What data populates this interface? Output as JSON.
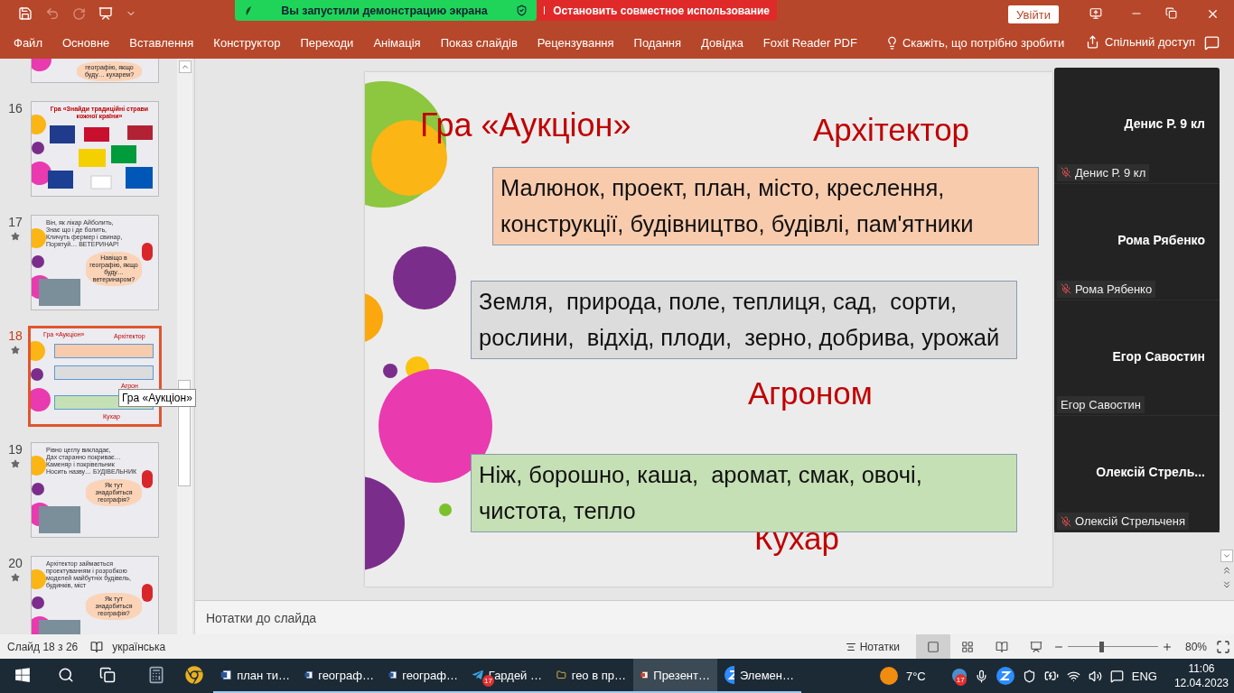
{
  "title_bar": {
    "share_banner": "Вы запустили демонстрацию экрана",
    "stop_button": "Остановить совместное использование",
    "sign_in": "Увійти"
  },
  "ribbon_tabs": [
    {
      "label": "Файл"
    },
    {
      "label": "Основне"
    },
    {
      "label": "Вставлення"
    },
    {
      "label": "Конструктор"
    },
    {
      "label": "Переходи"
    },
    {
      "label": "Анімація"
    },
    {
      "label": "Показ слайдів"
    },
    {
      "label": "Рецензування"
    },
    {
      "label": "Подання"
    },
    {
      "label": "Довідка"
    },
    {
      "label": "Foxit Reader PDF"
    }
  ],
  "tell_me": "Скажіть, що потрібно зробити",
  "share": "Спільний доступ",
  "thumbnails": [
    {
      "kind": "partial",
      "selected": false,
      "cloud": "географію, якщо буду… кухарем?"
    },
    {
      "kind": "flags",
      "number": "16",
      "selected": false,
      "lines": [
        "Гра «Знайди традиційні страви кожної країни»"
      ]
    },
    {
      "kind": "poem",
      "number": "17",
      "selected": false,
      "starred": true,
      "lines": [
        "Він, як лікар Айболить,",
        "Знає що і де болить,",
        "Кличуть фермер і свинар,",
        "Порятуй… ВЕТЕРИНАР!"
      ],
      "cloud": "Навіщо в географію, якщо буду… ветеринаром?"
    },
    {
      "kind": "mini",
      "number": "18",
      "selected": true,
      "starred": true,
      "lines": [
        "Гра «Аукціон»",
        "Архітектор",
        "Агрон",
        "Кухар"
      ]
    },
    {
      "kind": "poem",
      "number": "19",
      "selected": false,
      "starred": true,
      "lines": [
        "Рівно цеглу викладає,",
        "Дах старанно покриває…",
        "Каменяр і покрівельник",
        "Носить назву… БУДІВЕЛЬНИК"
      ],
      "cloud": "Як тут знадобиться географія?"
    },
    {
      "kind": "poem",
      "number": "20",
      "selected": false,
      "starred": true,
      "lines": [
        "Архітектор займається проектуванням і розробкою моделей майбутніх будівель, будинків, міст"
      ],
      "cloud": "Як тут знадобиться географія?"
    }
  ],
  "tooltip": "Гра «Аукціон»",
  "slide": {
    "title": "Гра «Аукціон»",
    "labels": [
      "Архітектор",
      "Агроном",
      "Кухар"
    ],
    "boxes": [
      {
        "text": "Малюнок, проект, план, місто, креслення, конструкції, будівництво, будівлі, пам'ятники",
        "color": "#f8cbad"
      },
      {
        "text": "Земля,  природа, поле, теплиця, сад,  сорти, рослини,  відхід, плоди,  зерно, добрива, урожай",
        "color": "#dcdcdc"
      },
      {
        "text": "Ніж, борошно, каша,  аромат, смак, овочі, чистота, тепло",
        "color": "#c5e0b4"
      }
    ]
  },
  "notes_placeholder": "Нотатки до слайда",
  "participants": [
    {
      "name": "Денис Р. 9 кл",
      "label": "Денис Р. 9 кл",
      "muted": true
    },
    {
      "name": "Рома Рябенко",
      "label": "Рома Рябенко",
      "muted": true
    },
    {
      "name": "Егор Савостин",
      "label": "Егор Савостин",
      "muted": false
    },
    {
      "name": "Олексій  Стрель...",
      "label": "Олексій Стрельченя",
      "muted": true
    }
  ],
  "status_bar": {
    "slide": "Слайд 18 з 26",
    "language": "українська",
    "notes": "Нотатки",
    "zoom": "80%",
    "level": 0.38
  },
  "taskbar": {
    "apps": [
      {
        "kind": "start"
      },
      {
        "kind": "search"
      },
      {
        "kind": "taskview"
      },
      {
        "kind": "calculator"
      },
      {
        "kind": "chrome"
      },
      {
        "kind": "word",
        "label": "план ти…",
        "selected": false
      },
      {
        "kind": "word",
        "label": "географ…",
        "selected": false
      },
      {
        "kind": "word",
        "label": "географ…",
        "selected": false
      },
      {
        "kind": "telegram",
        "label": "Гардей …",
        "badge": "17",
        "selected": false
      },
      {
        "kind": "folder",
        "label": "гео в пр…",
        "selected": false
      },
      {
        "kind": "powerpoint",
        "label": "Презент…",
        "selected": true
      },
      {
        "kind": "zoom",
        "label": "Элемен…",
        "selected": false
      }
    ],
    "weather": "7°C",
    "tray_badge": "17",
    "language": "ENG",
    "time": "11:06",
    "date": "12.04.2023"
  }
}
